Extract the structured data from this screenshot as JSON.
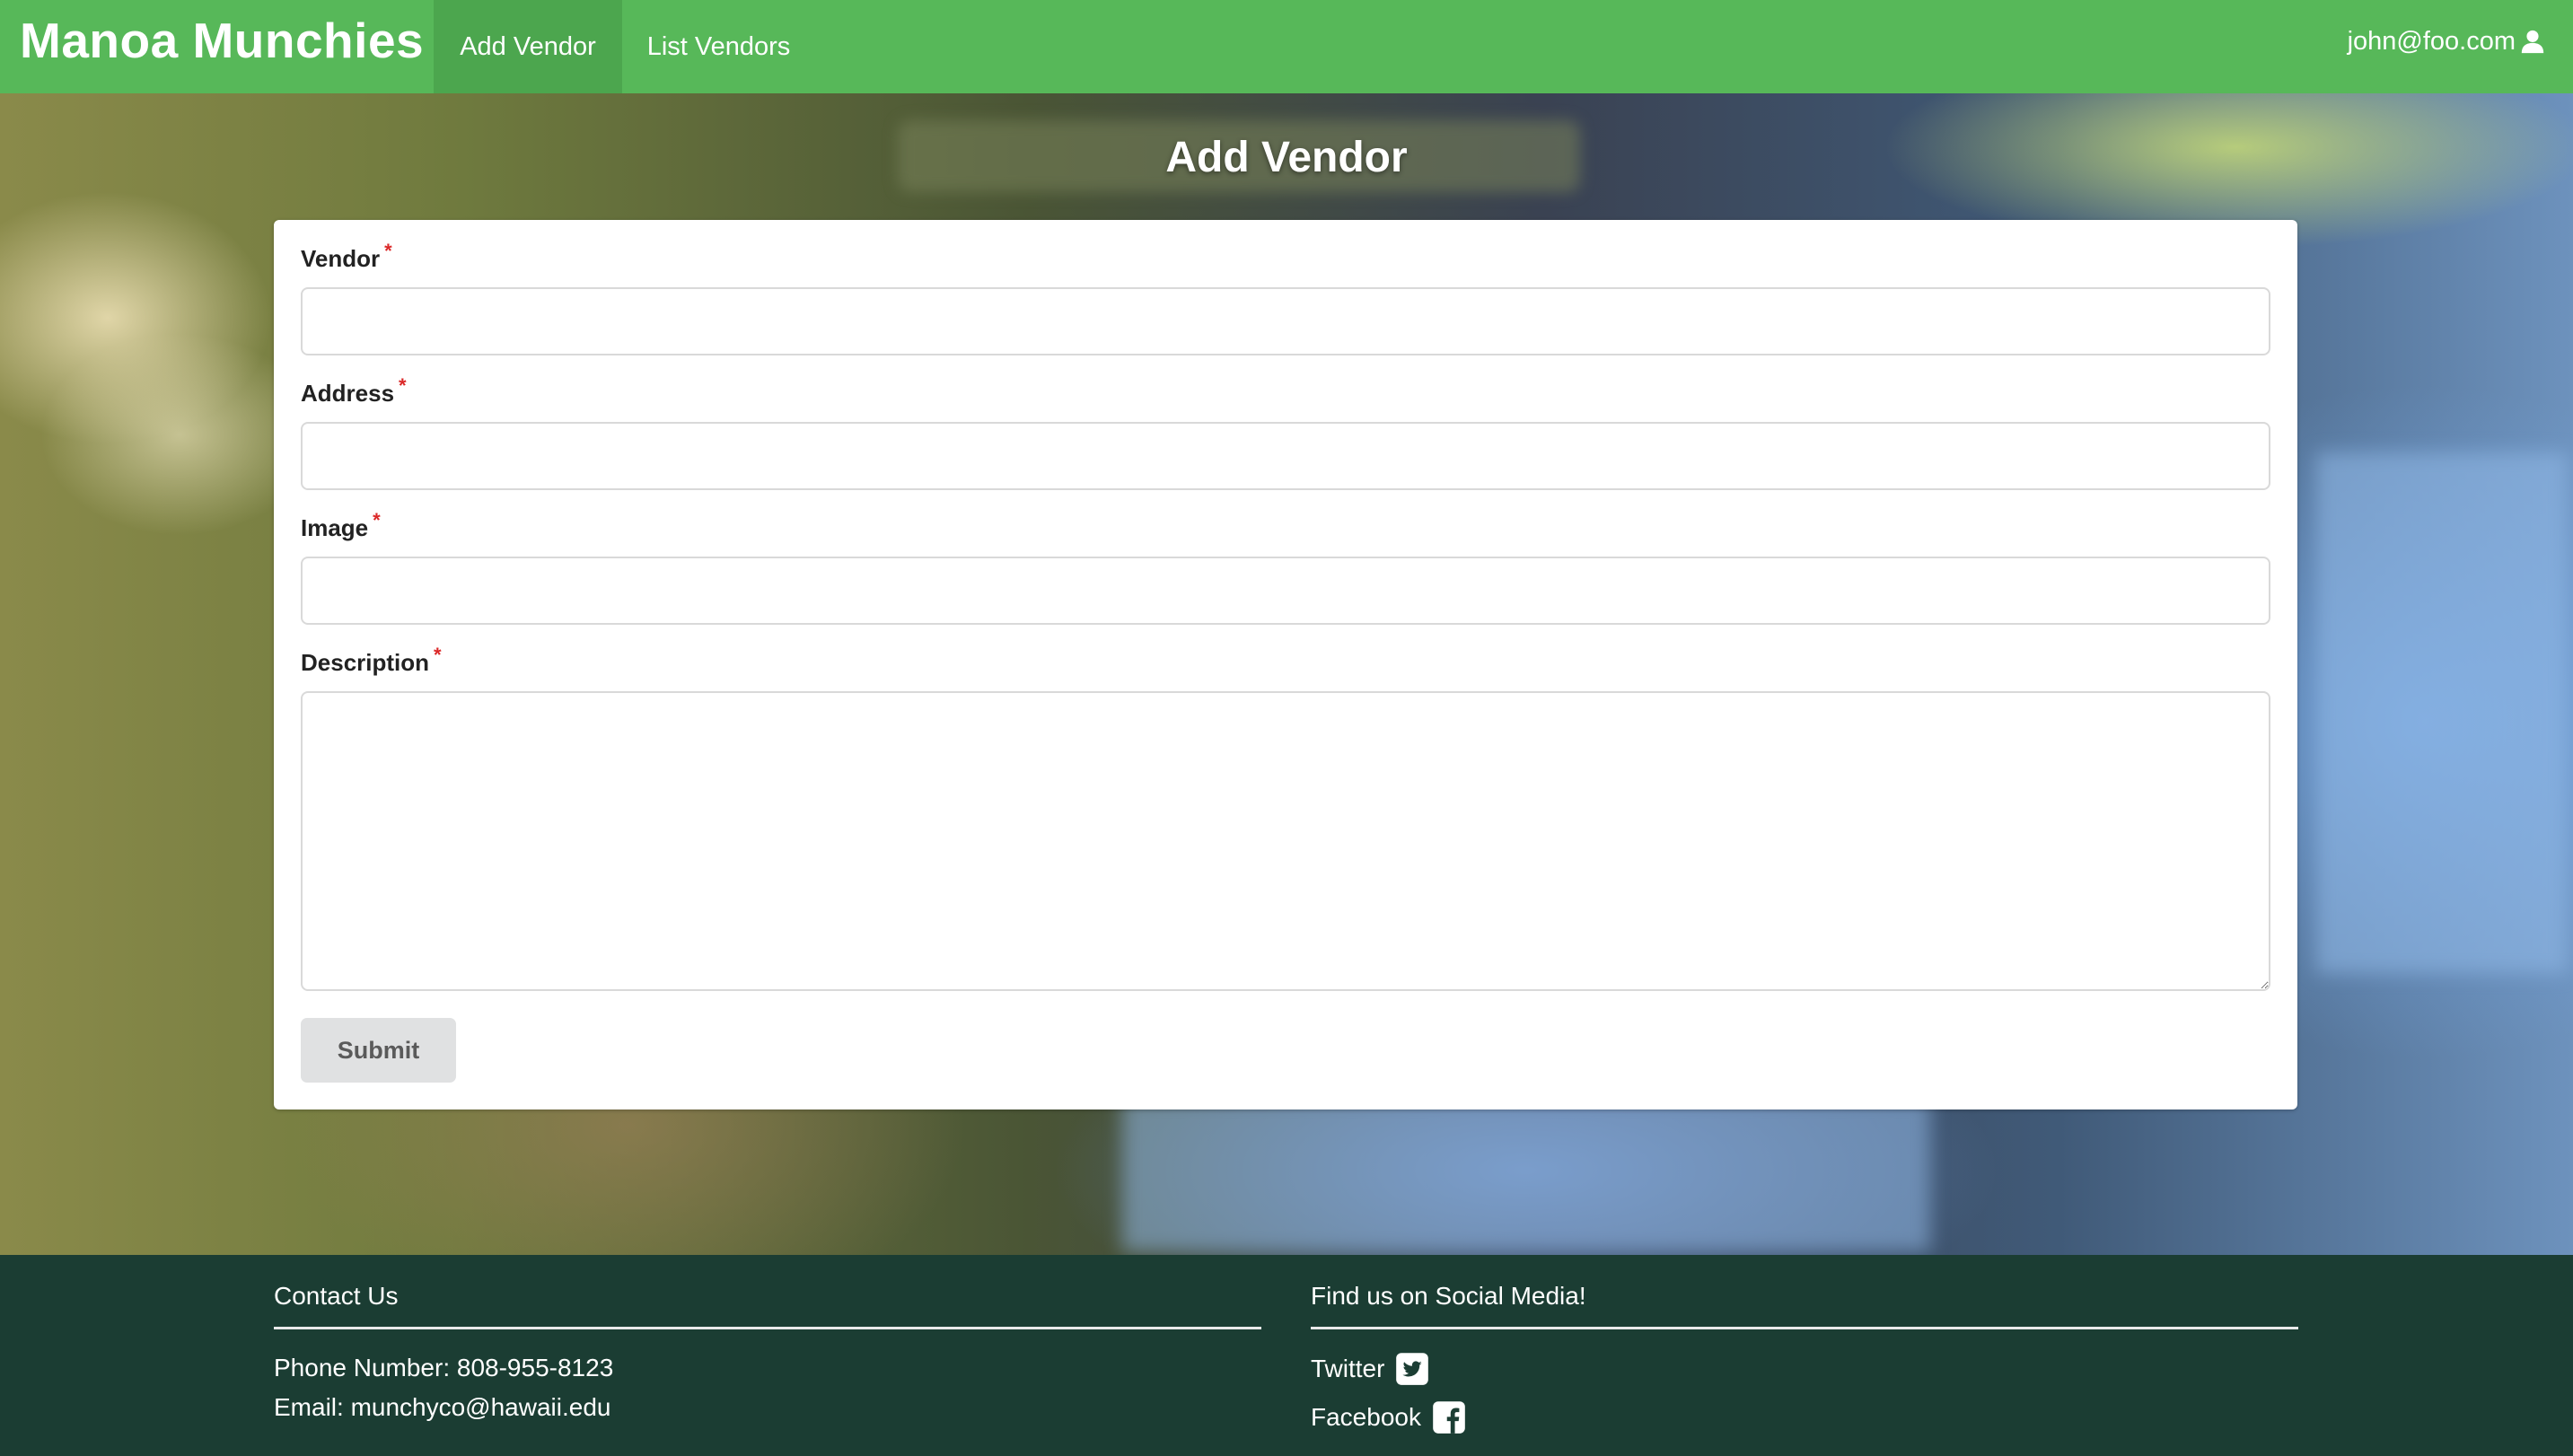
{
  "navbar": {
    "brand": "Manoa Munchies",
    "links": [
      {
        "label": "Add Vendor",
        "active": true
      },
      {
        "label": "List Vendors",
        "active": false
      }
    ],
    "user": {
      "email": "john@foo.com",
      "icon": "user-icon"
    }
  },
  "page": {
    "title": "Add Vendor"
  },
  "form": {
    "fields": [
      {
        "label": "Vendor",
        "required_mark": "*",
        "value": ""
      },
      {
        "label": "Address",
        "required_mark": "*",
        "value": ""
      },
      {
        "label": "Image",
        "required_mark": "*",
        "value": ""
      },
      {
        "label": "Description",
        "required_mark": "*",
        "value": ""
      }
    ],
    "submit_label": "Submit"
  },
  "footer": {
    "contact": {
      "heading": "Contact Us",
      "phone": "Phone Number: 808-955-8123",
      "email": "Email: munchyco@hawaii.edu"
    },
    "social": {
      "heading": "Find us on Social Media!",
      "links": [
        {
          "label": "Twitter",
          "icon": "twitter-square-icon"
        },
        {
          "label": "Facebook",
          "icon": "facebook-square-icon"
        }
      ]
    }
  },
  "colors": {
    "navbar": "#57b859",
    "navbar_active": "#4ca64e",
    "footer": "#1b3d33",
    "required": "#db2828",
    "button": "#e0e1e2"
  }
}
